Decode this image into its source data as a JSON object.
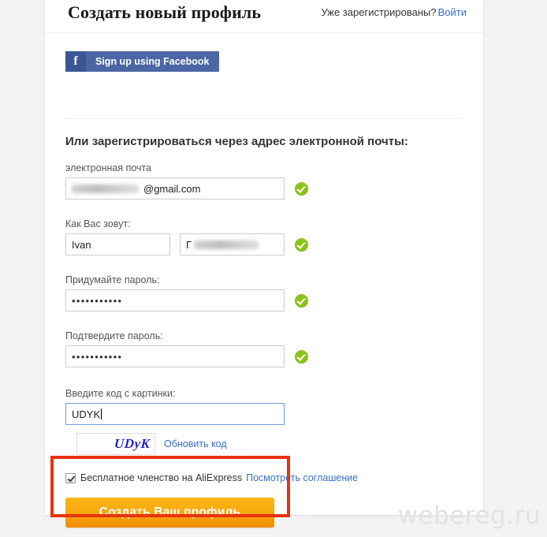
{
  "header": {
    "title": "Создать новый профиль",
    "already_registered_text": "Уже зарегистрированы?",
    "signin_link": "Войти"
  },
  "social": {
    "facebook_label": "Sign up using Facebook",
    "facebook_icon": "facebook-f-icon",
    "facebook_bg": "#4c66a4",
    "facebook_icon_bg": "#3a5795"
  },
  "form": {
    "section_heading": "Или зарегистрироваться через адрес электронной почты:",
    "email": {
      "label": "электронная почта",
      "value_visible": "@gmail.com",
      "value_redacted": true,
      "valid": true
    },
    "name": {
      "label": "Как Вас зовут:",
      "first_value": "Ivan",
      "last_value_visible": "Г",
      "last_value_redacted": true,
      "valid": true
    },
    "password": {
      "label": "Придумайте пароль:",
      "value": "•••••••••••",
      "valid": true
    },
    "password_confirm": {
      "label": "Подтвердите пароль:",
      "value": "•••••••••••",
      "valid": true
    },
    "captcha": {
      "label": "Введите код с картинки:",
      "input_value": "UDYK",
      "focused": true,
      "image_text": "UDyK",
      "refresh_link": "Обновить код"
    },
    "agreement": {
      "checked": true,
      "text": "Бесплатное членство на AliExpress",
      "link": "Посмотреть соглашение"
    },
    "submit_label": "Создать Ваш профиль"
  },
  "annotation": {
    "color": "#e8320c"
  },
  "watermark": {
    "text": "webereg.ru"
  },
  "icons": {
    "valid_check": "check-circle-icon"
  }
}
